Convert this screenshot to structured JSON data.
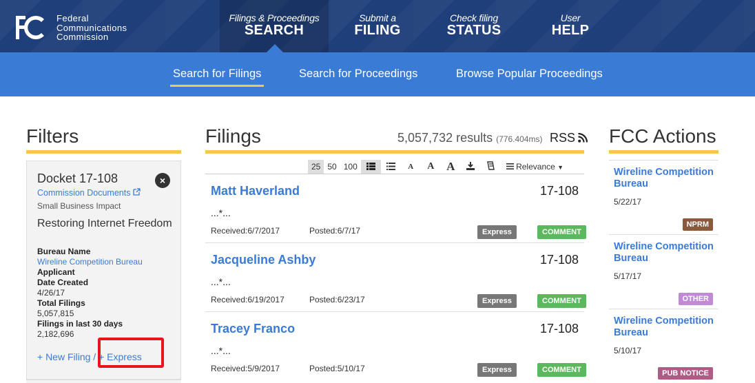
{
  "logo": {
    "lines": [
      "Federal",
      "Communications",
      "Commission"
    ]
  },
  "nav": [
    {
      "small": "Filings & Proceedings",
      "big": "SEARCH"
    },
    {
      "small": "Submit a",
      "big": "FILING"
    },
    {
      "small": "Check filing",
      "big": "STATUS"
    },
    {
      "small": "User",
      "big": "HELP"
    }
  ],
  "subnav": [
    "Search for Filings",
    "Search for Proceedings",
    "Browse Popular Proceedings"
  ],
  "filters": {
    "heading": "Filters",
    "title": "Docket 17-108",
    "close": "×",
    "commission_link": "Commission Documents",
    "sub": "Small Business Impact",
    "name": "Restoring Internet Freedom",
    "bureau_label": "Bureau Name",
    "bureau_value": "Wireline Competition Bureau",
    "applicant_label": "Applicant",
    "date_label": "Date Created",
    "date_value": "4/26/17",
    "total_label": "Total Filings",
    "total_value": "5,057,815",
    "last30_label": "Filings in last 30 days",
    "last30_value": "2,182,696",
    "new_filing": "+ New Filing / + Express"
  },
  "filings": {
    "heading": "Filings",
    "results": "5,057,732 results",
    "ms": "(776.404ms)",
    "rss": "RSS",
    "toolbar": [
      "25",
      "50",
      "100"
    ],
    "sort": "Relevance",
    "rows": [
      {
        "name": "Matt Haverland",
        "docket": "17-108",
        "excerpt": "...*...",
        "received": "Received:6/7/2017",
        "posted": "Posted:6/7/17",
        "express": "Express",
        "comment": "COMMENT"
      },
      {
        "name": "Jacqueline Ashby",
        "docket": "17-108",
        "excerpt": "...*...",
        "received": "Received:6/19/2017",
        "posted": "Posted:6/23/17",
        "express": "Express",
        "comment": "COMMENT"
      },
      {
        "name": "Tracey Franco",
        "docket": "17-108",
        "excerpt": "...*...",
        "received": "Received:5/9/2017",
        "posted": "Posted:5/10/17",
        "express": "Express",
        "comment": "COMMENT"
      }
    ]
  },
  "actions": {
    "heading": "FCC Actions",
    "items": [
      {
        "title": "Wireline Competition Bureau",
        "date": "5/22/17",
        "badge": "NPRM",
        "color": "#8b5a3c"
      },
      {
        "title": "Wireline Competition Bureau",
        "date": "5/17/17",
        "badge": "OTHER",
        "color": "#c08ad6"
      },
      {
        "title": "Wireline Competition Bureau",
        "date": "5/10/17",
        "badge": "PUB NOTICE",
        "color": "#b05a86"
      }
    ]
  },
  "colors": {
    "header": "#1f3f7a",
    "subbar": "#3a7bd5",
    "accent": "#f3c84b",
    "link": "#3a7bd5",
    "comment": "#5cb85c",
    "express": "#777777",
    "annotation": "#e8141b"
  }
}
